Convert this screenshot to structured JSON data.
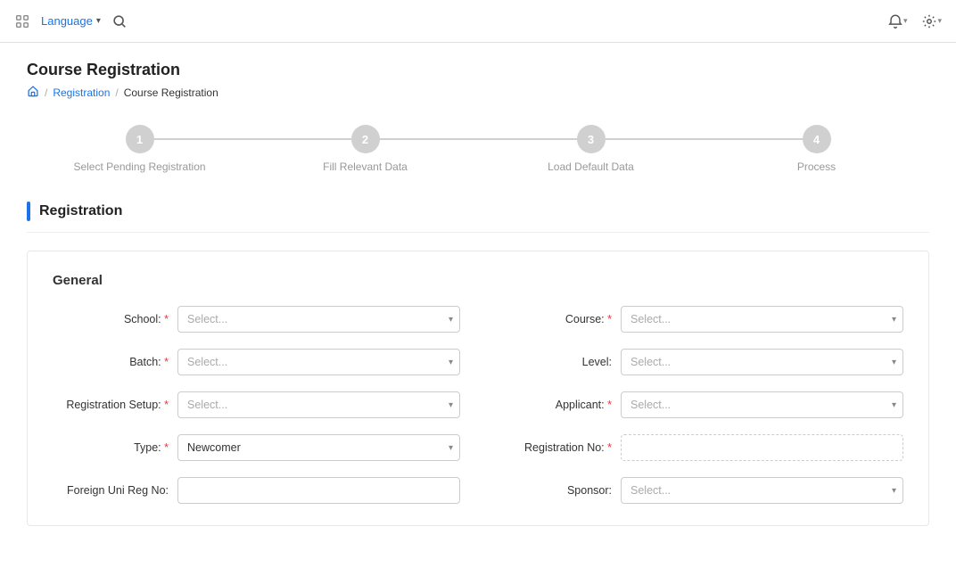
{
  "topnav": {
    "language_label": "Language",
    "bell_icon": "bell-icon",
    "settings_icon": "gear-icon",
    "search_icon": "search-icon",
    "grid_icon": "grid-icon"
  },
  "page": {
    "title": "Course Registration",
    "breadcrumb": {
      "home": "home",
      "registration": "Registration",
      "current": "Course Registration"
    }
  },
  "stepper": {
    "steps": [
      {
        "number": "1",
        "label": "Select Pending Registration",
        "active": false
      },
      {
        "number": "2",
        "label": "Fill Relevant Data",
        "active": false
      },
      {
        "number": "3",
        "label": "Load Default Data",
        "active": false
      },
      {
        "number": "4",
        "label": "Process",
        "active": false
      }
    ]
  },
  "registration_section": {
    "title": "Registration"
  },
  "general": {
    "title": "General",
    "fields": {
      "school": {
        "label": "School:",
        "required": true,
        "placeholder": "Select...",
        "value": ""
      },
      "course": {
        "label": "Course:",
        "required": true,
        "placeholder": "Select...",
        "value": ""
      },
      "batch": {
        "label": "Batch:",
        "required": true,
        "placeholder": "Select...",
        "value": ""
      },
      "level": {
        "label": "Level:",
        "required": false,
        "placeholder": "Select...",
        "value": ""
      },
      "registration_setup": {
        "label": "Registration Setup:",
        "required": true,
        "placeholder": "Select...",
        "value": ""
      },
      "applicant": {
        "label": "Applicant:",
        "required": true,
        "placeholder": "Select...",
        "value": ""
      },
      "type": {
        "label": "Type:",
        "required": true,
        "placeholder": "Newcomer",
        "value": "Newcomer"
      },
      "registration_no": {
        "label": "Registration No:",
        "required": true,
        "placeholder": "",
        "value": ""
      },
      "foreign_uni_reg_no": {
        "label": "Foreign Uni Reg No:",
        "required": false,
        "placeholder": "",
        "value": ""
      },
      "sponsor": {
        "label": "Sponsor:",
        "required": false,
        "placeholder": "Select...",
        "value": ""
      }
    }
  }
}
